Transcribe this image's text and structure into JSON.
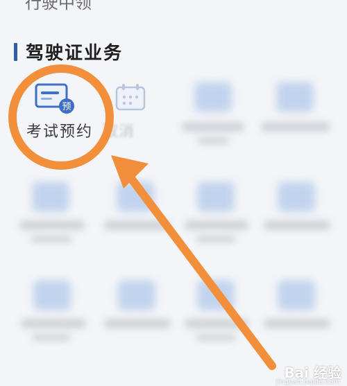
{
  "top_partial_text": "行驶中领",
  "section": {
    "title": "驾驶证业务"
  },
  "items": {
    "exam_booking": {
      "label": "考试预约",
      "badge": "预"
    },
    "cancel": {
      "label_partial": "取消"
    }
  },
  "colors": {
    "accent_blue": "#2f5fa7",
    "highlight_orange": "#f28f3b",
    "background": "#f4f5f8"
  },
  "watermark": {
    "text": "Bai 经验",
    "sub": "jingyan.baidu.com"
  }
}
